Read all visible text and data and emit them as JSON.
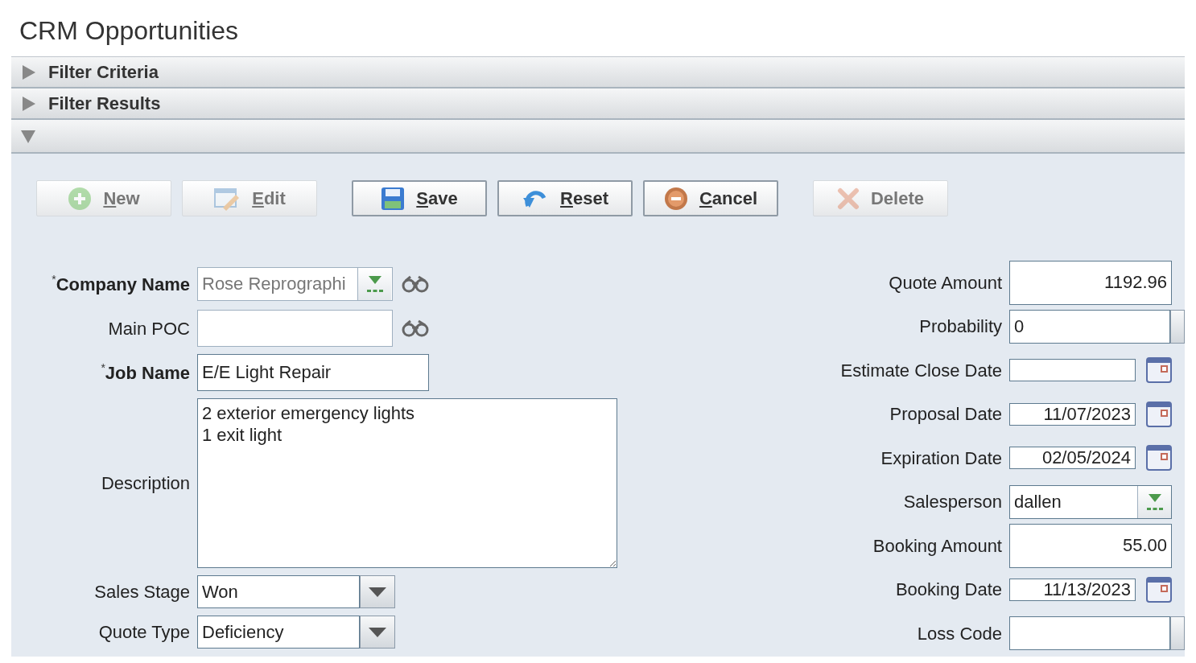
{
  "page": {
    "title": "CRM Opportunities"
  },
  "sections": [
    {
      "label": "Filter Criteria",
      "expanded": false
    },
    {
      "label": "Filter Results",
      "expanded": false
    },
    {
      "expanded": true
    }
  ],
  "toolbar": [
    [
      {
        "label": "New",
        "disabled": true,
        "mnemonic": true
      },
      {
        "label": "Edit",
        "disabled": true,
        "mnemonic": true
      }
    ],
    [
      {
        "label": "Save",
        "disabled": false,
        "mnemonic": true
      },
      {
        "label": "Reset",
        "disabled": false,
        "mnemonic": true
      },
      {
        "label": "Cancel",
        "disabled": false,
        "mnemonic": true
      }
    ],
    [
      {
        "label": "Delete",
        "disabled": true,
        "mnemonic": false
      }
    ]
  ],
  "left_fields": [
    {
      "label": "Company Name",
      "required_mark": "*",
      "kind": "lookup",
      "value": "Rose Reprographi",
      "disabled": true,
      "binoculars": true
    },
    {
      "label": "Main POC",
      "kind": "text",
      "disabled": false,
      "binoculars": true
    },
    {
      "label": "Job Name",
      "required_mark": "*",
      "kind": "text",
      "value": "E/E Light Repair",
      "disabled": false,
      "binoculars": false
    },
    {
      "label": "Description",
      "kind": "textarea",
      "value": "2 exterior emergency lights\n1 exit light",
      "disabled": false,
      "binoculars": false
    },
    {
      "label": "Sales Stage",
      "kind": "select",
      "value": "Won",
      "disabled": false,
      "binoculars": false
    },
    {
      "label": "Quote Type",
      "kind": "select",
      "value": "Deficiency",
      "disabled": false,
      "binoculars": false
    }
  ],
  "right_fields": [
    {
      "label": "Quote Amount",
      "kind": "number",
      "value": "1192.96"
    },
    {
      "label": "Probability",
      "kind": "select",
      "value": "0"
    },
    {
      "label": "Estimate Close Date",
      "kind": "date"
    },
    {
      "label": "Proposal Date",
      "kind": "date",
      "value": "11/07/2023"
    },
    {
      "label": "Expiration Date",
      "kind": "date",
      "value": "02/05/2024"
    },
    {
      "label": "Salesperson",
      "kind": "lookup",
      "value": "dallen"
    },
    {
      "label": "Booking Amount",
      "kind": "number",
      "value": "55.00"
    },
    {
      "label": "Booking Date",
      "kind": "date",
      "value": "11/13/2023"
    },
    {
      "label": "Loss Code",
      "kind": "select"
    }
  ]
}
